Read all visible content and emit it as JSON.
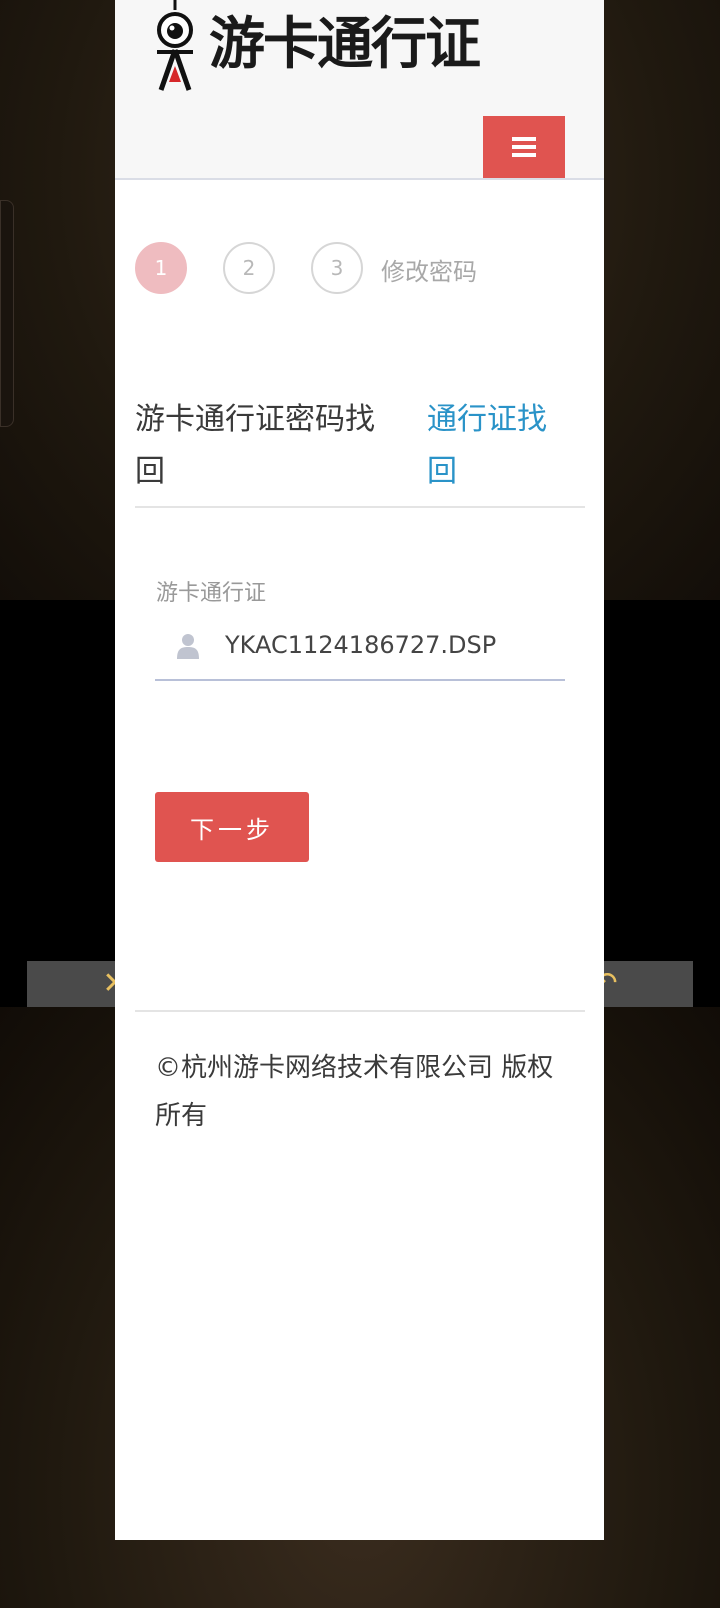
{
  "header": {
    "logo_text": "游卡通行证",
    "menu_icon": "hamburger-icon"
  },
  "steps": {
    "items": [
      {
        "number": "1",
        "active": true
      },
      {
        "number": "2",
        "active": false
      },
      {
        "number": "3",
        "active": false
      }
    ],
    "final_label": "修改密码"
  },
  "main": {
    "title": "游卡通行证密码找回",
    "alt_link": "通行证找回"
  },
  "form": {
    "field_label": "游卡通行证",
    "field_value": "YKAC1124186727.DSP",
    "field_icon": "user-icon",
    "next_button": "下一步"
  },
  "footer": {
    "copyright": "©杭州游卡网络技术有限公司 版权所有"
  },
  "background": {
    "close_glyph": "✕",
    "back_glyph": "↶"
  },
  "colors": {
    "accent_red": "#e05450",
    "link_blue": "#2a93c8",
    "active_step": "#efbcc0"
  }
}
